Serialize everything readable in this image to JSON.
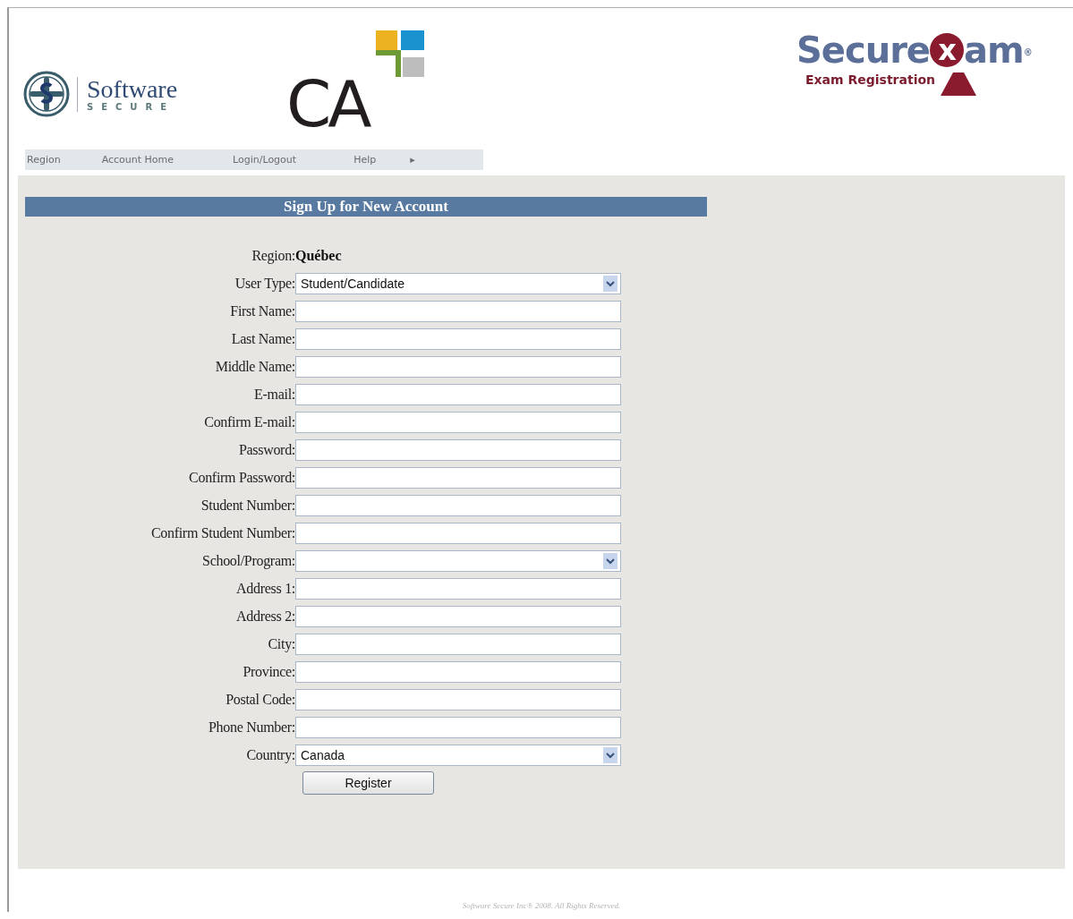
{
  "header": {
    "software_secure": {
      "name": "Software",
      "tagline": "SECURE"
    },
    "ca_logo": {
      "text": "CA"
    },
    "securexam": {
      "before": "Secure",
      "middle": "x",
      "after": "am",
      "mark": "®",
      "subtitle": "Exam Registration"
    }
  },
  "nav": {
    "items": [
      {
        "label": "Region"
      },
      {
        "label": "Account Home"
      },
      {
        "label": "Login/Logout"
      },
      {
        "label": "Help"
      },
      {
        "label": "▸"
      }
    ]
  },
  "form": {
    "title": "Sign Up for New Account",
    "fields": [
      {
        "kind": "static",
        "label": "Region:",
        "value": "Québec"
      },
      {
        "kind": "select",
        "label": "User Type:",
        "value": "Student/Candidate"
      },
      {
        "kind": "text",
        "label": "First Name:"
      },
      {
        "kind": "text",
        "label": "Last Name:"
      },
      {
        "kind": "text",
        "label": "Middle Name:"
      },
      {
        "kind": "text",
        "label": "E-mail:"
      },
      {
        "kind": "text",
        "label": "Confirm E-mail:"
      },
      {
        "kind": "text",
        "label": "Password:"
      },
      {
        "kind": "text",
        "label": "Confirm Password:"
      },
      {
        "kind": "text",
        "label": "Student Number:"
      },
      {
        "kind": "text",
        "label": "Confirm Student Number:"
      },
      {
        "kind": "select",
        "label": "School/Program:"
      },
      {
        "kind": "text",
        "label": "Address 1:"
      },
      {
        "kind": "text",
        "label": "Address 2:"
      },
      {
        "kind": "text",
        "label": "City:"
      },
      {
        "kind": "text",
        "label": "Province:"
      },
      {
        "kind": "text",
        "label": "Postal Code:"
      },
      {
        "kind": "text",
        "label": "Phone Number:"
      },
      {
        "kind": "select",
        "label": "Country:",
        "value": "Canada"
      }
    ],
    "submit": "Register"
  },
  "footer": "Software Secure Inc® 2008. All Rights Reserved."
}
